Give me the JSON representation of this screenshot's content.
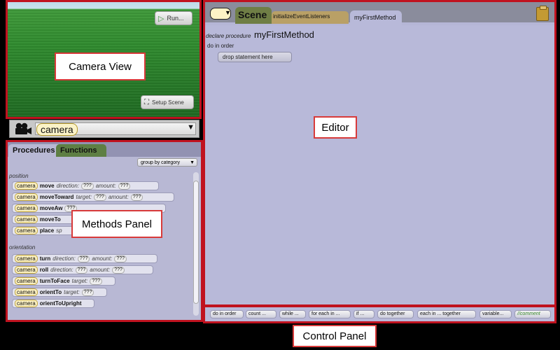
{
  "camera_view": {
    "run_label": "Run...",
    "setup_scene_label": "Setup Scene",
    "callout": "Camera View"
  },
  "camera_selector": {
    "selected": "camera"
  },
  "methods_panel": {
    "tabs": [
      "Procedures",
      "Functions"
    ],
    "group_by": "group by category",
    "callout": "Methods Panel",
    "category_position": "position",
    "category_orientation": "orientation",
    "subject": "camera",
    "rows": [
      {
        "method": "move",
        "p1": "direction:",
        "v1": "???",
        "p2": "amount:",
        "v2": "???"
      },
      {
        "method": "moveToward",
        "p1": "target:",
        "v1": "???",
        "p2": "amount:",
        "v2": "???"
      },
      {
        "method": "moveAw",
        "p1": "",
        "v1": "",
        "p2": "",
        "v2": "???"
      },
      {
        "method": "moveTo",
        "p1": "",
        "v1": "",
        "p2": "",
        "v2": ""
      },
      {
        "method": "place",
        "p1": "sp",
        "v1": "",
        "p2": "",
        "v2": ""
      },
      {
        "method": "turn",
        "p1": "direction:",
        "v1": "???",
        "p2": "amount:",
        "v2": "???"
      },
      {
        "method": "roll",
        "p1": "direction:",
        "v1": "???",
        "p2": "amount:",
        "v2": "???"
      },
      {
        "method": "turnToFace",
        "p1": "target:",
        "v1": "???",
        "p2": "",
        "v2": ""
      },
      {
        "method": "orientTo",
        "p1": "target:",
        "v1": "???",
        "p2": "",
        "v2": ""
      },
      {
        "method": "orientToUpright",
        "p1": "",
        "v1": "",
        "p2": "",
        "v2": ""
      }
    ]
  },
  "editor": {
    "tabs": [
      "Scene",
      "initializeEventListeners",
      "myFirstMethod"
    ],
    "declare_label": "declare procedure",
    "procedure_name": "myFirstMethod",
    "do_in_order": "do in order",
    "drop_label": "drop statement here",
    "callout": "Editor"
  },
  "control_panel": {
    "buttons": [
      "do in order",
      "count ...",
      "while ...",
      "for each in ...",
      "if ...",
      "do together",
      "each in ... together",
      "variable...",
      "//comment"
    ],
    "callout": "Control Panel"
  },
  "colors": {
    "annotation_red": "#c0121f",
    "panel_lavender": "#b8b9d9"
  }
}
